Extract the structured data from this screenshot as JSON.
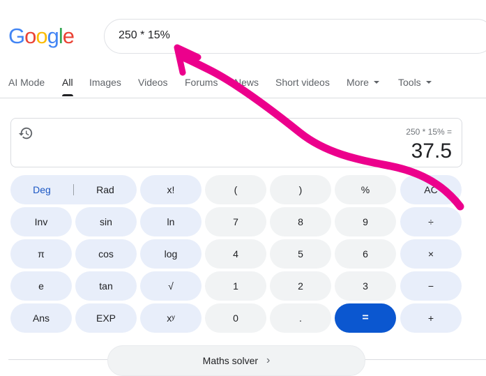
{
  "header": {
    "logo_letters": [
      {
        "ch": "G",
        "color": "#4285F4"
      },
      {
        "ch": "o",
        "color": "#EA4335"
      },
      {
        "ch": "o",
        "color": "#FBBC05"
      },
      {
        "ch": "g",
        "color": "#4285F4"
      },
      {
        "ch": "l",
        "color": "#34A853"
      },
      {
        "ch": "e",
        "color": "#EA4335"
      }
    ],
    "search_value": "250 * 15%"
  },
  "tabs": [
    {
      "label": "AI Mode"
    },
    {
      "label": "All",
      "active": true
    },
    {
      "label": "Images"
    },
    {
      "label": "Videos"
    },
    {
      "label": "Forums"
    },
    {
      "label": "News"
    },
    {
      "label": "Short videos"
    },
    {
      "label": "More",
      "dropdown": true
    },
    {
      "label": "Tools",
      "dropdown": true
    }
  ],
  "calculator": {
    "history_icon": "history-icon",
    "expression": "250 * 15% =",
    "result": "37.5",
    "deg_label": "Deg",
    "rad_label": "Rad",
    "keys": [
      [
        "x!",
        "(",
        ")",
        "%",
        "AC"
      ],
      [
        "Inv",
        "sin",
        "ln",
        "7",
        "8",
        "9",
        "÷"
      ],
      [
        "π",
        "cos",
        "log",
        "4",
        "5",
        "6",
        "×"
      ],
      [
        "e",
        "tan",
        "√",
        "1",
        "2",
        "3",
        "−"
      ],
      [
        "Ans",
        "EXP",
        "xʸ",
        "0",
        ".",
        "=",
        "+"
      ]
    ]
  },
  "solver": {
    "label": "Maths solver",
    "chevron_icon": "chevron-right-icon"
  },
  "annotation": {
    "color": "#EC008C",
    "type": "hand-drawn-arrow"
  }
}
